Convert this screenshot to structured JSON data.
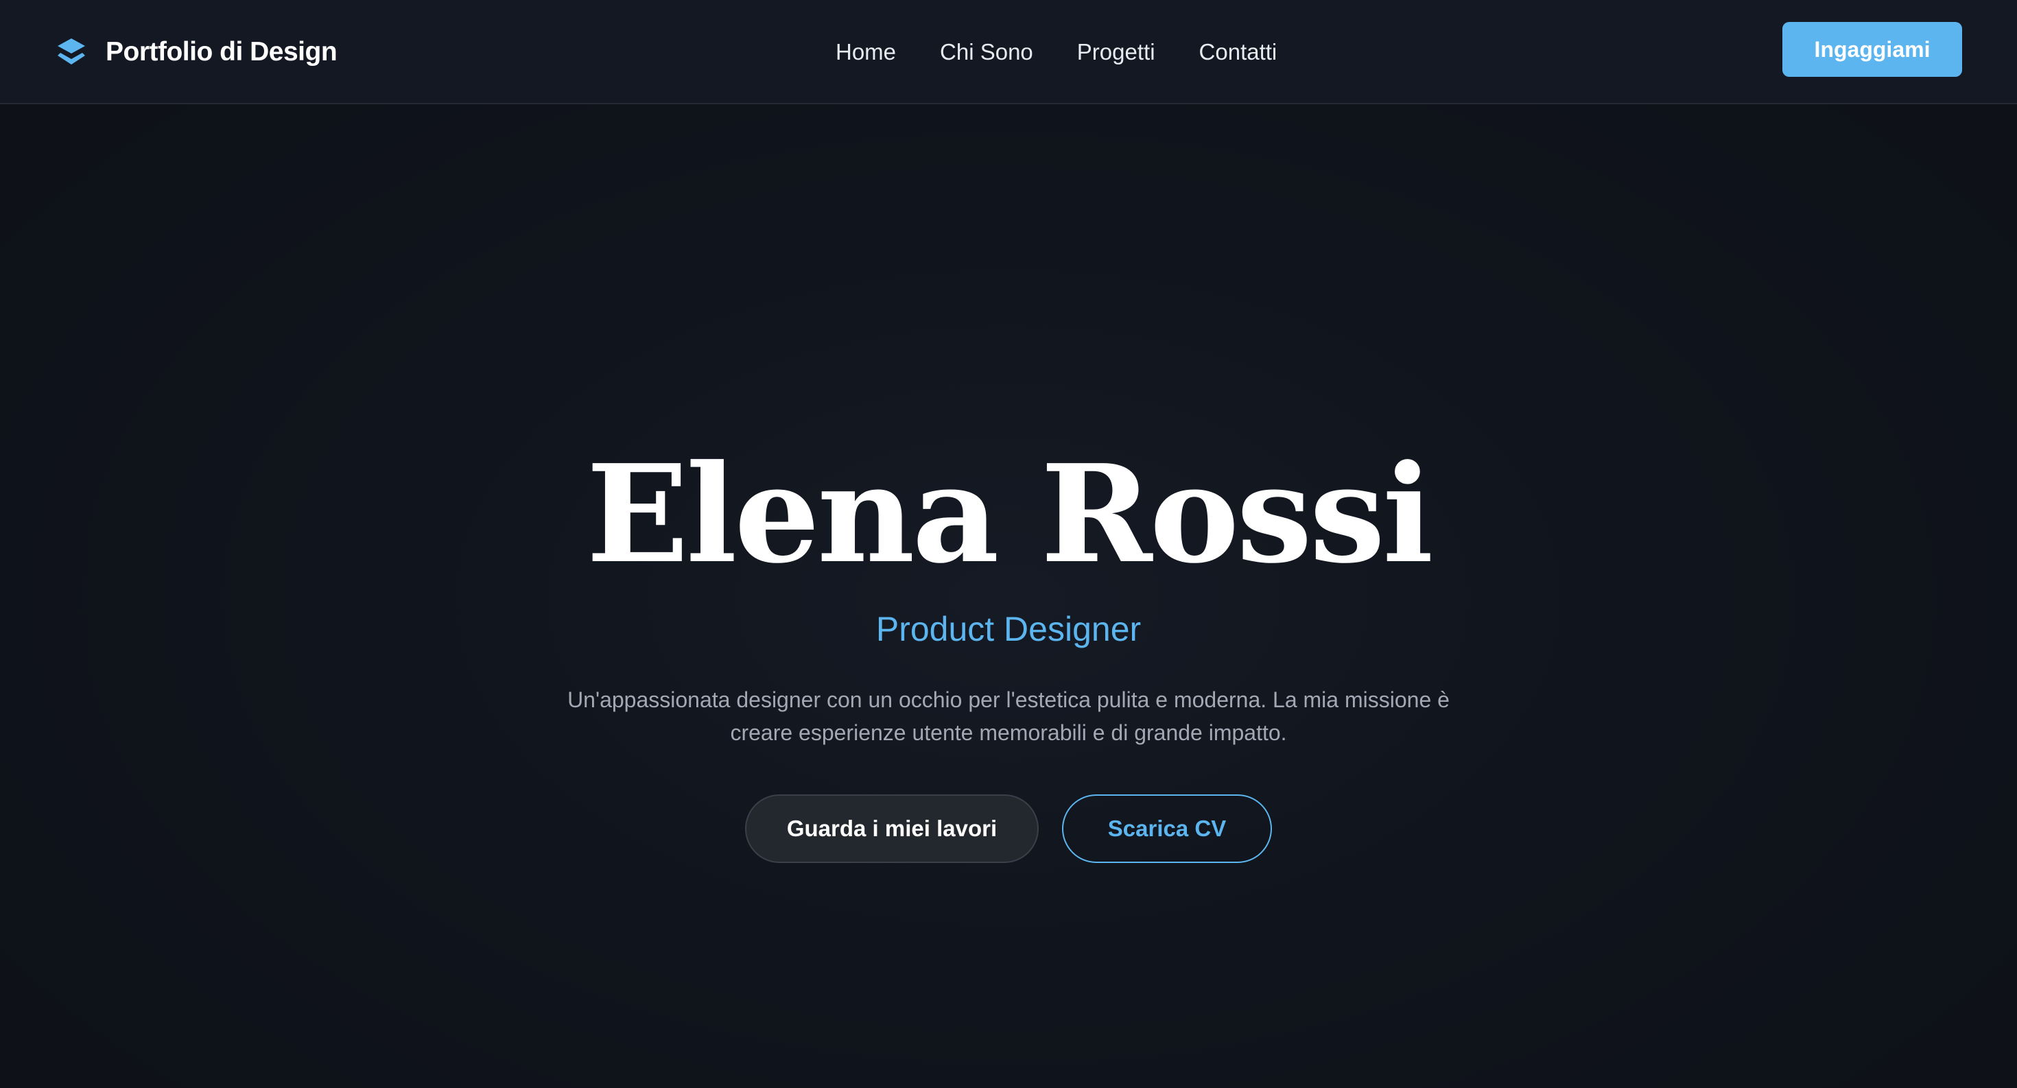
{
  "header": {
    "brand_icon": "layers-icon",
    "brand_name": "Portfolio di Design",
    "nav": [
      {
        "label": "Home"
      },
      {
        "label": "Chi Sono"
      },
      {
        "label": "Progetti"
      },
      {
        "label": "Contatti"
      }
    ],
    "cta_label": "Ingaggiami"
  },
  "hero": {
    "name": "Elena Rossi",
    "role": "Product Designer",
    "description": "Un'appassionata designer con un occhio per l'estetica pulita e moderna. La mia missione è creare esperienze utente memorabili e di grande impatto.",
    "primary_button": "Guarda i miei lavori",
    "secondary_button": "Scarica CV"
  },
  "colors": {
    "accent": "#5cb5ee",
    "background": "#0f1219",
    "header_background": "#131823",
    "text_primary": "#ffffff",
    "text_muted": "#a3a9b4"
  }
}
